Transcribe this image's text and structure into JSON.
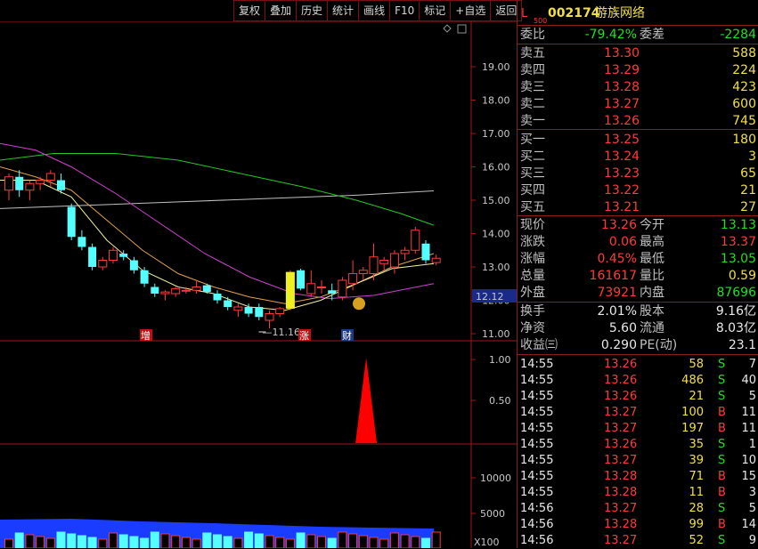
{
  "toolbar": {
    "buttons": [
      "复权",
      "叠加",
      "历史",
      "统计",
      "画线",
      "F10",
      "标记",
      "+自选",
      "返回"
    ]
  },
  "stock": {
    "prefix": "L",
    "sub": "500",
    "code": "002174",
    "name": "游族网络"
  },
  "quote_header": {
    "weibi_label": "委比",
    "weibi": "-79.42%",
    "weicha_label": "委差",
    "weicha": "-2284"
  },
  "asks": [
    {
      "label": "卖五",
      "price": "13.30",
      "vol": "588"
    },
    {
      "label": "卖四",
      "price": "13.29",
      "vol": "224"
    },
    {
      "label": "卖三",
      "price": "13.28",
      "vol": "423"
    },
    {
      "label": "卖二",
      "price": "13.27",
      "vol": "600"
    },
    {
      "label": "卖一",
      "price": "13.26",
      "vol": "745"
    }
  ],
  "bids": [
    {
      "label": "买一",
      "price": "13.25",
      "vol": "180"
    },
    {
      "label": "买二",
      "price": "13.24",
      "vol": "3"
    },
    {
      "label": "买三",
      "price": "13.23",
      "vol": "65"
    },
    {
      "label": "买四",
      "price": "13.22",
      "vol": "21"
    },
    {
      "label": "买五",
      "price": "13.21",
      "vol": "27"
    }
  ],
  "stats": [
    {
      "l1": "现价",
      "v1": "13.26",
      "l2": "今开",
      "v2": "13.13"
    },
    {
      "l1": "涨跌",
      "v1": "0.06",
      "l2": "最高",
      "v2": "13.37"
    },
    {
      "l1": "涨幅",
      "v1": "0.45%",
      "l2": "最低",
      "v2": "13.05"
    },
    {
      "l1": "总量",
      "v1": "161617",
      "l2": "量比",
      "v2": "0.59"
    },
    {
      "l1": "外盘",
      "v1": "73921",
      "l2": "内盘",
      "v2": "87696"
    }
  ],
  "stats2": [
    {
      "l1": "换手",
      "v1": "2.01%",
      "l2": "股本",
      "v2": "9.16亿"
    },
    {
      "l1": "净资",
      "v1": "5.60",
      "l2": "流通",
      "v2": "8.03亿"
    },
    {
      "l1": "收益㈢",
      "v1": "0.290",
      "l2": "PE(动)",
      "v2": "23.1"
    }
  ],
  "ticks": [
    {
      "time": "14:55",
      "price": "13.26",
      "vol": "58",
      "bs": "S",
      "n": "7"
    },
    {
      "time": "14:55",
      "price": "13.26",
      "vol": "486",
      "bs": "S",
      "n": "40"
    },
    {
      "time": "14:55",
      "price": "13.26",
      "vol": "21",
      "bs": "S",
      "n": "5"
    },
    {
      "time": "14:55",
      "price": "13.27",
      "vol": "100",
      "bs": "B",
      "n": "11"
    },
    {
      "time": "14:55",
      "price": "13.27",
      "vol": "197",
      "bs": "B",
      "n": "11"
    },
    {
      "time": "14:55",
      "price": "13.26",
      "vol": "35",
      "bs": "S",
      "n": "1"
    },
    {
      "time": "14:55",
      "price": "13.27",
      "vol": "39",
      "bs": "S",
      "n": "10"
    },
    {
      "time": "14:55",
      "price": "13.28",
      "vol": "71",
      "bs": "B",
      "n": "15"
    },
    {
      "time": "14:55",
      "price": "13.28",
      "vol": "11",
      "bs": "B",
      "n": "3"
    },
    {
      "time": "14:56",
      "price": "13.27",
      "vol": "28",
      "bs": "S",
      "n": "5"
    },
    {
      "time": "14:56",
      "price": "13.28",
      "vol": "99",
      "bs": "B",
      "n": "14"
    },
    {
      "time": "14:56",
      "price": "13.27",
      "vol": "52",
      "bs": "S",
      "n": "9"
    }
  ],
  "chart_data": {
    "type": "candlestick",
    "price_axis_ticks": [
      "19.00",
      "18.00",
      "17.00",
      "16.00",
      "15.00",
      "14.00",
      "13.00",
      "12.00",
      "11.00"
    ],
    "current_price_label": "12.12",
    "low_marker_label": "11.16",
    "event_markers": [
      "增",
      "涨",
      "财"
    ],
    "indicator_axis_ticks": [
      "1.00",
      "0.50"
    ],
    "volume_axis_ticks": [
      "10000",
      "5000"
    ],
    "volume_unit": "X100",
    "candles": [
      {
        "o": 15.3,
        "h": 15.8,
        "l": 15.0,
        "c": 15.7
      },
      {
        "o": 15.7,
        "h": 15.9,
        "l": 15.1,
        "c": 15.3
      },
      {
        "o": 15.3,
        "h": 15.6,
        "l": 15.0,
        "c": 15.5
      },
      {
        "o": 15.5,
        "h": 15.7,
        "l": 15.3,
        "c": 15.6
      },
      {
        "o": 15.6,
        "h": 15.9,
        "l": 15.4,
        "c": 15.8
      },
      {
        "o": 15.6,
        "h": 15.8,
        "l": 15.2,
        "c": 15.3
      },
      {
        "o": 14.8,
        "h": 14.9,
        "l": 13.8,
        "c": 13.9
      },
      {
        "o": 13.9,
        "h": 14.1,
        "l": 13.5,
        "c": 13.6
      },
      {
        "o": 13.6,
        "h": 13.7,
        "l": 12.9,
        "c": 13.0
      },
      {
        "o": 13.0,
        "h": 13.3,
        "l": 12.9,
        "c": 13.2
      },
      {
        "o": 13.2,
        "h": 13.6,
        "l": 13.1,
        "c": 13.5
      },
      {
        "o": 13.4,
        "h": 13.5,
        "l": 13.2,
        "c": 13.3
      },
      {
        "o": 13.2,
        "h": 13.3,
        "l": 12.8,
        "c": 12.9
      },
      {
        "o": 12.9,
        "h": 13.0,
        "l": 12.4,
        "c": 12.5
      },
      {
        "o": 12.4,
        "h": 12.5,
        "l": 12.1,
        "c": 12.2
      },
      {
        "o": 12.2,
        "h": 12.3,
        "l": 12.0,
        "c": 12.25
      },
      {
        "o": 12.2,
        "h": 12.4,
        "l": 12.1,
        "c": 12.35
      },
      {
        "o": 12.3,
        "h": 12.4,
        "l": 12.2,
        "c": 12.3
      },
      {
        "o": 12.3,
        "h": 12.6,
        "l": 12.2,
        "c": 12.4
      },
      {
        "o": 12.45,
        "h": 12.5,
        "l": 12.2,
        "c": 12.25
      },
      {
        "o": 12.2,
        "h": 12.3,
        "l": 11.9,
        "c": 12.0
      },
      {
        "o": 12.0,
        "h": 12.1,
        "l": 11.7,
        "c": 11.8
      },
      {
        "o": 11.7,
        "h": 11.9,
        "l": 11.5,
        "c": 11.8
      },
      {
        "o": 11.8,
        "h": 11.9,
        "l": 11.5,
        "c": 11.6
      },
      {
        "o": 11.8,
        "h": 11.9,
        "l": 11.4,
        "c": 11.5
      },
      {
        "o": 11.4,
        "h": 11.7,
        "l": 11.16,
        "c": 11.6
      },
      {
        "o": 11.6,
        "h": 11.8,
        "l": 11.5,
        "c": 11.75
      },
      {
        "o": 11.75,
        "h": 12.9,
        "l": 11.7,
        "c": 12.85
      },
      {
        "o": 12.9,
        "h": 12.95,
        "l": 12.3,
        "c": 12.35
      },
      {
        "o": 12.2,
        "h": 12.9,
        "l": 12.1,
        "c": 12.5
      },
      {
        "o": 12.4,
        "h": 12.6,
        "l": 12.2,
        "c": 12.4
      },
      {
        "o": 12.3,
        "h": 12.5,
        "l": 12.0,
        "c": 12.2
      },
      {
        "o": 12.1,
        "h": 12.7,
        "l": 12.0,
        "c": 12.6
      },
      {
        "o": 12.5,
        "h": 13.2,
        "l": 12.3,
        "c": 12.8
      },
      {
        "o": 12.8,
        "h": 13.0,
        "l": 12.6,
        "c": 12.9
      },
      {
        "o": 12.8,
        "h": 13.7,
        "l": 12.6,
        "c": 13.3
      },
      {
        "o": 13.1,
        "h": 13.3,
        "l": 12.9,
        "c": 13.2
      },
      {
        "o": 13.0,
        "h": 13.5,
        "l": 12.8,
        "c": 13.4
      },
      {
        "o": 13.4,
        "h": 13.6,
        "l": 13.2,
        "c": 13.5
      },
      {
        "o": 13.5,
        "h": 14.2,
        "l": 13.4,
        "c": 14.1
      },
      {
        "o": 13.7,
        "h": 13.8,
        "l": 13.1,
        "c": 13.2
      },
      {
        "o": 13.13,
        "h": 13.37,
        "l": 13.05,
        "c": 13.26
      }
    ],
    "indicator_spike": {
      "index": 33,
      "value": 1.0
    },
    "volume_note": "volume bars at bottom, approx values in hundreds"
  }
}
